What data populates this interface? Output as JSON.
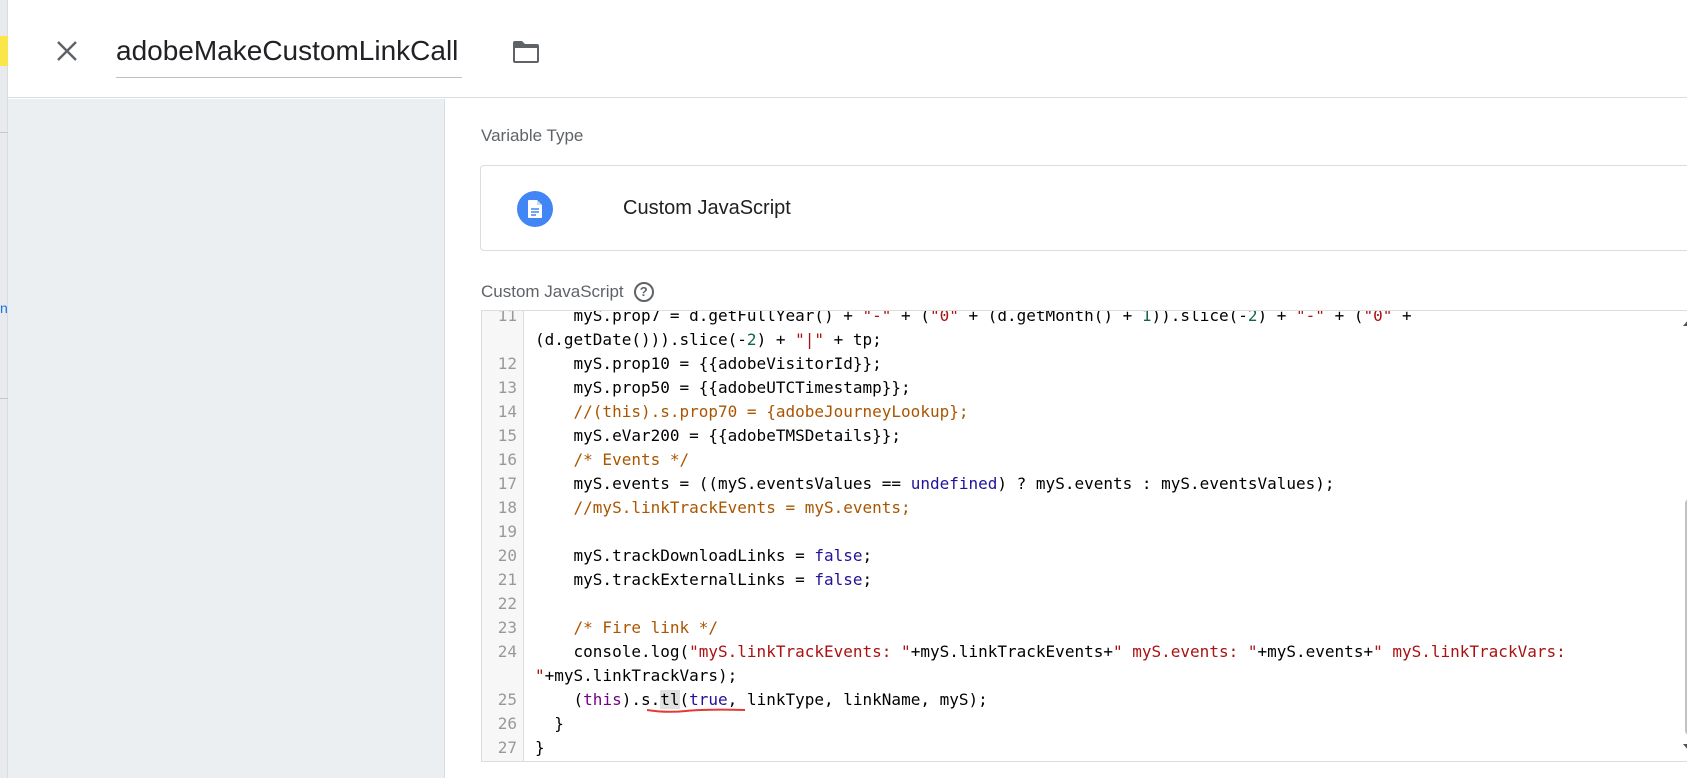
{
  "header": {
    "title": "adobeMakeCustomLinkCall",
    "close_icon": "close-icon",
    "folder_icon": "folder-icon"
  },
  "left_edge": {
    "partial_text": "n"
  },
  "main": {
    "variable_type_label": "Variable Type",
    "variable_type": "Custom JavaScript",
    "variable_type_icon": "document-icon",
    "code_label": "Custom JavaScript",
    "help_icon": "help-icon"
  },
  "colors": {
    "accent": "#4285f4",
    "sidebar_bg": "#eceff1",
    "comment": "#aa5500",
    "string": "#a11",
    "keyword": "#708",
    "atom": "#219",
    "number": "#164"
  },
  "code": {
    "lines": [
      {
        "n": "11",
        "tokens": [
          {
            "t": "    myS.prop7 = d.getFullYear() + "
          },
          {
            "t": "\"-\"",
            "c": "str"
          },
          {
            "t": " + ("
          },
          {
            "t": "\"0\"",
            "c": "str"
          },
          {
            "t": " + (d.getMonth() + "
          },
          {
            "t": "1",
            "c": "num"
          },
          {
            "t": ")).slice(-"
          },
          {
            "t": "2",
            "c": "num"
          },
          {
            "t": ") + "
          },
          {
            "t": "\"-\"",
            "c": "str"
          },
          {
            "t": " + ("
          },
          {
            "t": "\"0\"",
            "c": "str"
          },
          {
            "t": " +"
          }
        ]
      },
      {
        "n": "",
        "tokens": [
          {
            "t": "(d.getDate())).slice(-"
          },
          {
            "t": "2",
            "c": "num"
          },
          {
            "t": ") + "
          },
          {
            "t": "\"|\"",
            "c": "str"
          },
          {
            "t": " + tp;"
          }
        ]
      },
      {
        "n": "12",
        "tokens": [
          {
            "t": "    myS.prop10 = {{adobeVisitorId}};"
          }
        ]
      },
      {
        "n": "13",
        "tokens": [
          {
            "t": "    myS.prop50 = {{adobeUTCTimestamp}};"
          }
        ]
      },
      {
        "n": "14",
        "tokens": [
          {
            "t": "    "
          },
          {
            "t": "//(this).s.prop70 = {adobeJourneyLookup};",
            "c": "com"
          }
        ]
      },
      {
        "n": "15",
        "tokens": [
          {
            "t": "    myS.eVar200 = {{adobeTMSDetails}};"
          }
        ]
      },
      {
        "n": "16",
        "tokens": [
          {
            "t": "    "
          },
          {
            "t": "/* Events */",
            "c": "com"
          }
        ]
      },
      {
        "n": "17",
        "tokens": [
          {
            "t": "    myS.events = ((myS.eventsValues == "
          },
          {
            "t": "undefined",
            "c": "atom"
          },
          {
            "t": ") ? myS.events : myS.eventsValues);"
          }
        ]
      },
      {
        "n": "18",
        "tokens": [
          {
            "t": "    "
          },
          {
            "t": "//myS.linkTrackEvents = myS.events;",
            "c": "com"
          }
        ]
      },
      {
        "n": "19",
        "tokens": [
          {
            "t": ""
          }
        ]
      },
      {
        "n": "20",
        "tokens": [
          {
            "t": "    myS.trackDownloadLinks = "
          },
          {
            "t": "false",
            "c": "atom"
          },
          {
            "t": ";"
          }
        ]
      },
      {
        "n": "21",
        "tokens": [
          {
            "t": "    myS.trackExternalLinks = "
          },
          {
            "t": "false",
            "c": "atom"
          },
          {
            "t": ";"
          }
        ]
      },
      {
        "n": "22",
        "tokens": [
          {
            "t": ""
          }
        ]
      },
      {
        "n": "23",
        "tokens": [
          {
            "t": "    "
          },
          {
            "t": "/* Fire link */",
            "c": "com"
          }
        ]
      },
      {
        "n": "24",
        "tokens": [
          {
            "t": "    console.log("
          },
          {
            "t": "\"myS.linkTrackEvents: \"",
            "c": "str"
          },
          {
            "t": "+myS.linkTrackEvents+"
          },
          {
            "t": "\" myS.events: \"",
            "c": "str"
          },
          {
            "t": "+myS.events+"
          },
          {
            "t": "\" myS.linkTrackVars:",
            "c": "str"
          }
        ]
      },
      {
        "n": "",
        "tokens": [
          {
            "t": "\"",
            "c": "str"
          },
          {
            "t": "+myS.linkTrackVars);"
          }
        ]
      },
      {
        "n": "25",
        "tokens": [
          {
            "t": "    ("
          },
          {
            "t": "this",
            "c": "kw"
          },
          {
            "t": ").s."
          },
          {
            "t": "tl",
            "c": "hl"
          },
          {
            "t": "("
          },
          {
            "t": "true",
            "c": "atom"
          },
          {
            "t": ", linkType, linkName, myS);"
          }
        ],
        "annotated": true
      },
      {
        "n": "26",
        "tokens": [
          {
            "t": "  }"
          }
        ]
      },
      {
        "n": "27",
        "tokens": [
          {
            "t": "}"
          }
        ]
      }
    ]
  }
}
